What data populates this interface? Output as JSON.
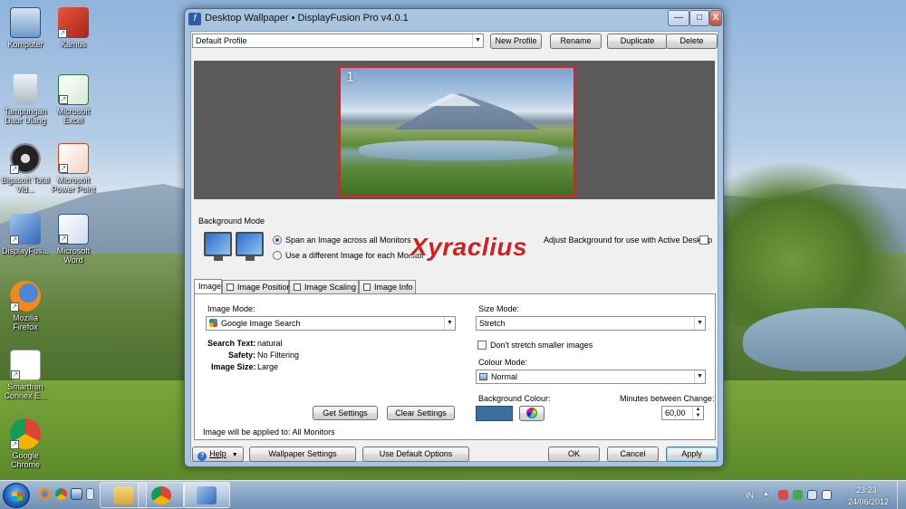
{
  "desktop": {
    "icons": [
      {
        "label": "Komputer",
        "icon": "computer-icon"
      },
      {
        "label": "Kamus",
        "icon": "book-icon"
      },
      {
        "label": "Tampungan Daur Ulang",
        "icon": "recycle-bin-icon"
      },
      {
        "label": "Microsoft Excel",
        "icon": "excel-icon"
      },
      {
        "label": "Bigasoft Total Vid...",
        "icon": "video-reel-icon"
      },
      {
        "label": "Microsoft Power Point",
        "icon": "powerpoint-icon"
      },
      {
        "label": "DisplayFus...",
        "icon": "displayfusion-icon"
      },
      {
        "label": "Microsoft Word",
        "icon": "word-icon"
      },
      {
        "label": "Mozilla Firefox",
        "icon": "firefox-icon"
      },
      {
        "label": "Smartfren Connex E...",
        "icon": "smartfren-icon"
      },
      {
        "label": "Google Chrome",
        "icon": "chrome-icon"
      }
    ]
  },
  "window": {
    "title": "Desktop Wallpaper • DisplayFusion Pro v4.0.1",
    "controls": {
      "minimize": "—",
      "maximize": "□",
      "close": "X"
    }
  },
  "profile": {
    "selected": "Default Profile",
    "buttons": {
      "new": "New Profile",
      "rename": "Rename",
      "duplicate": "Duplicate",
      "delete": "Delete"
    }
  },
  "preview": {
    "monitor_number": "1"
  },
  "background_mode": {
    "group_label": "Background Mode",
    "span_label": "Span an Image across all Monitors",
    "different_label": "Use a different Image for each Monitor",
    "adjust_label": "Adjust Background for use with Active Desktop",
    "selected": "span"
  },
  "watermark": "Xyraclius",
  "tabs": [
    {
      "label": "Image",
      "active": true
    },
    {
      "label": "Image Position",
      "active": false
    },
    {
      "label": "Image Scaling",
      "active": false
    },
    {
      "label": "Image Info",
      "active": false
    }
  ],
  "image_tab": {
    "image_mode_label": "Image Mode:",
    "image_mode_value": "Google Image Search",
    "search_text_label": "Search Text:",
    "search_text_value": "natural",
    "safety_label": "Safety:",
    "safety_value": "No Filtering",
    "image_size_label": "Image Size:",
    "image_size_value": "Large",
    "get_settings": "Get Settings",
    "clear_settings": "Clear Settings",
    "applied_to": "Image will be applied to: All Monitors",
    "size_mode_label": "Size Mode:",
    "size_mode_value": "Stretch",
    "dont_stretch_label": "Don't stretch smaller images",
    "colour_mode_label": "Colour Mode:",
    "colour_mode_value": "Normal",
    "background_colour_label": "Background Colour:",
    "background_colour": "#3c6ea0",
    "minutes_label": "Minutes between Change:",
    "minutes_value": "60,00"
  },
  "footer": {
    "help": "Help",
    "wallpaper_settings": "Wallpaper Settings",
    "use_default": "Use Default Options",
    "ok": "OK",
    "cancel": "Cancel",
    "apply": "Apply"
  },
  "taskbar": {
    "language": "IN",
    "time": "23:23",
    "date": "24/06/2012"
  }
}
